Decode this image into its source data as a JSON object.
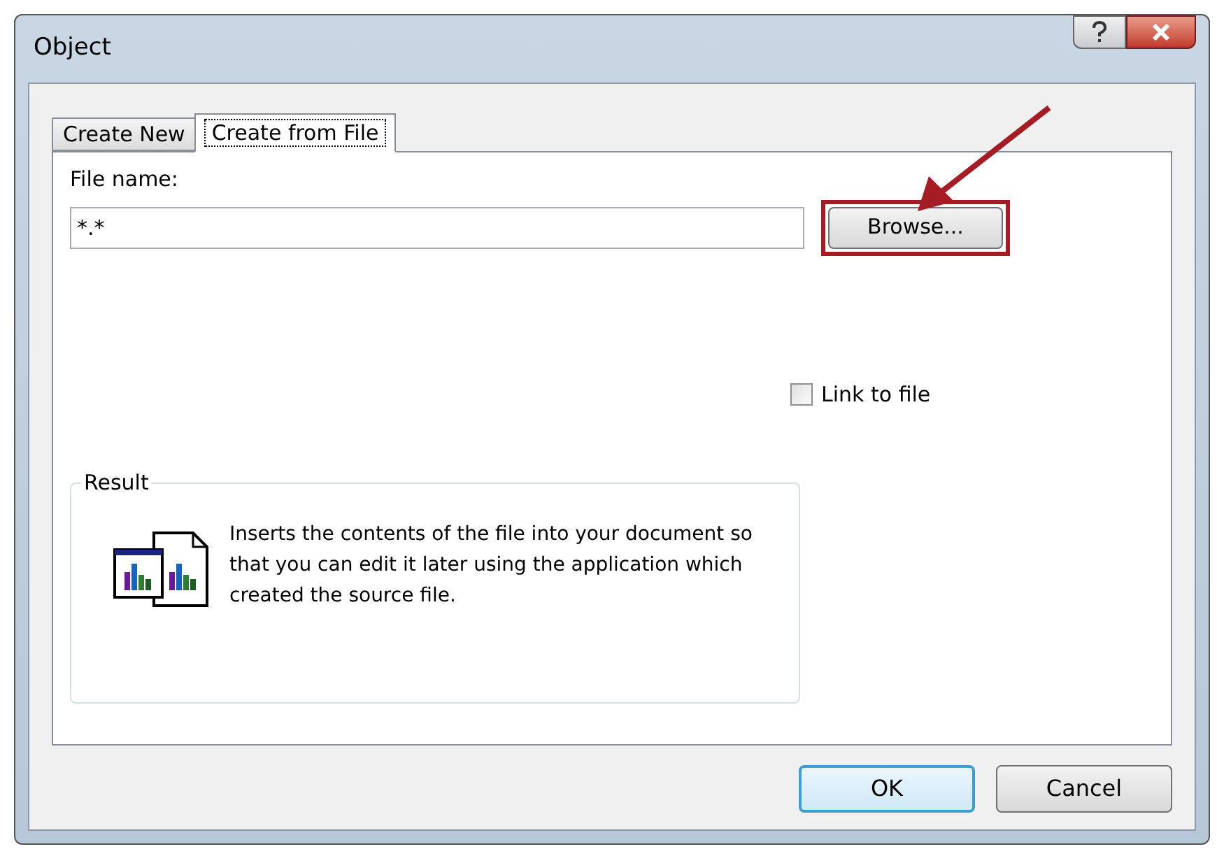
{
  "window": {
    "title": "Object"
  },
  "tabs": [
    {
      "label": "Create New",
      "selected": false
    },
    {
      "label": "Create from File",
      "selected": true
    }
  ],
  "file_name": {
    "label": "File name:",
    "value": "*.*"
  },
  "browse_button": "Browse...",
  "link_to_file": {
    "label": "Link to file",
    "checked": false
  },
  "result": {
    "title": "Result",
    "description": "Inserts the contents of the file into your document so that you can edit it later using the application which created the source file."
  },
  "buttons": [
    {
      "label": "OK",
      "default": true
    },
    {
      "label": "Cancel",
      "default": false
    }
  ]
}
